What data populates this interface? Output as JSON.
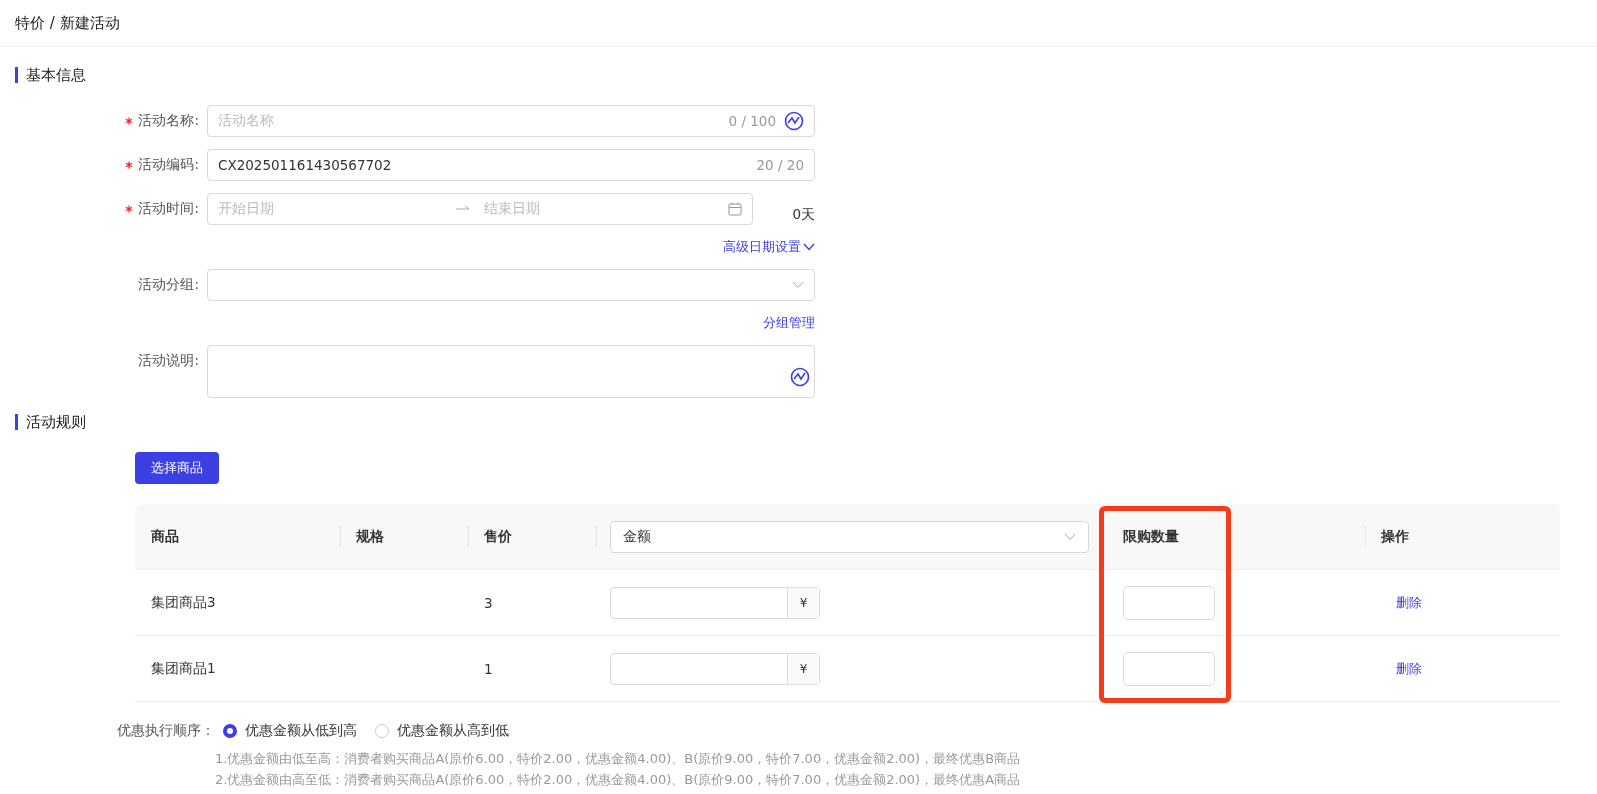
{
  "breadcrumb": "特价 / 新建活动",
  "basic_section": {
    "title": "基本信息",
    "fields": [
      {
        "kind": "text",
        "label": "活动名称:",
        "required": true,
        "placeholder": "活动名称",
        "counter": "0 / 100",
        "ai_icon": true
      },
      {
        "kind": "text",
        "label": "活动编码:",
        "required": true,
        "value": "CX202501161430567702",
        "counter": "20 / 20",
        "ai_icon": false
      },
      {
        "kind": "daterange",
        "label": "活动时间:",
        "required": true,
        "start_placeholder": "开始日期",
        "end_placeholder": "结束日期",
        "days": "0天",
        "link": "高级日期设置"
      },
      {
        "kind": "select",
        "label": "活动分组:",
        "required": false,
        "link": "分组管理"
      },
      {
        "kind": "textarea",
        "label": "活动说明:",
        "required": false,
        "ai_icon": true
      }
    ]
  },
  "rules_section": {
    "title": "活动规则",
    "button": "选择商品",
    "table": {
      "columns": [
        "商品",
        "规格",
        "售价",
        "限购数量",
        "操作"
      ],
      "price_mode_select": "金额",
      "currency": "¥",
      "rows": [
        {
          "product": "集团商品3",
          "price": "3",
          "action": "删除"
        },
        {
          "product": "集团商品1",
          "price": "1",
          "action": "删除"
        }
      ],
      "limit_column_highlighted": true
    },
    "order": {
      "label": "优惠执行顺序：",
      "options": [
        {
          "label": "优惠金额从低到高",
          "selected": true
        },
        {
          "label": "优惠金额从高到低",
          "selected": false
        }
      ],
      "notes": [
        "1.优惠金额由低至高：消费者购买商品A(原价6.00，特价2.00，优惠金额4.00)、B(原价9.00，特价7.00，优惠金额2.00)，最终优惠B商品",
        "2.优惠金额由高至低：消费者购买商品A(原价6.00，特价2.00，优惠金额4.00)、B(原价9.00，特价7.00，优惠金额2.00)，最终优惠A商品"
      ]
    }
  }
}
